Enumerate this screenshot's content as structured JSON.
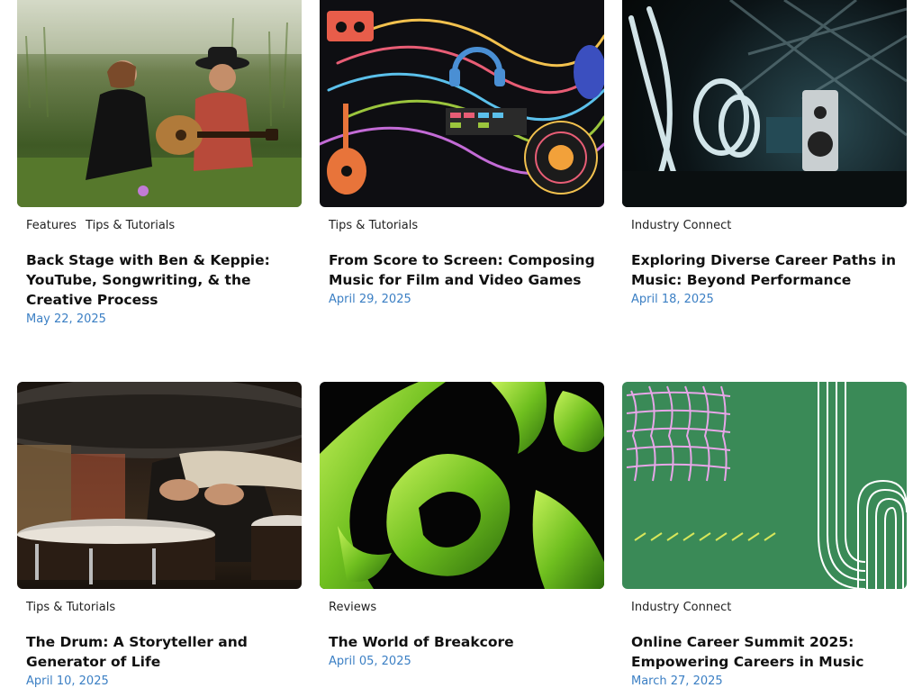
{
  "cards": [
    {
      "image_alt": "Two musicians sitting in grass with a guitar",
      "categories": [
        "Features",
        "Tips & Tutorials"
      ],
      "title": "Back Stage with Ben & Keppie: YouTube, Songwriting, & the Creative Process",
      "date": "May 22, 2025"
    },
    {
      "image_alt": "Colorful music doodles illustration",
      "categories": [
        "Tips & Tutorials"
      ],
      "title": "From Score to Screen: Composing Music for Film and Video Games",
      "date": "April 29, 2025"
    },
    {
      "image_alt": "Light painting in a studio with speakers",
      "categories": [
        "Industry Connect"
      ],
      "title": "Exploring Diverse Career Paths in Music: Beyond Performance",
      "date": "April 18, 2025"
    },
    {
      "image_alt": "Close-up of a drummer playing",
      "categories": [
        "Tips & Tutorials"
      ],
      "title": "The Drum: A Storyteller and Generator of Life",
      "date": "April 10, 2025"
    },
    {
      "image_alt": "Green glossy abstract shapes on black",
      "categories": [
        "Reviews"
      ],
      "title": "The World of Breakcore",
      "date": "April 05, 2025"
    },
    {
      "image_alt": "Green graphic with pink grid and white lines",
      "categories": [
        "Industry Connect"
      ],
      "title": "Online Career Summit 2025: Empowering Careers in Music",
      "date": "March 27, 2025"
    }
  ],
  "colors": {
    "date": "#3b7fc4",
    "title": "#111111",
    "category": "#222222"
  }
}
